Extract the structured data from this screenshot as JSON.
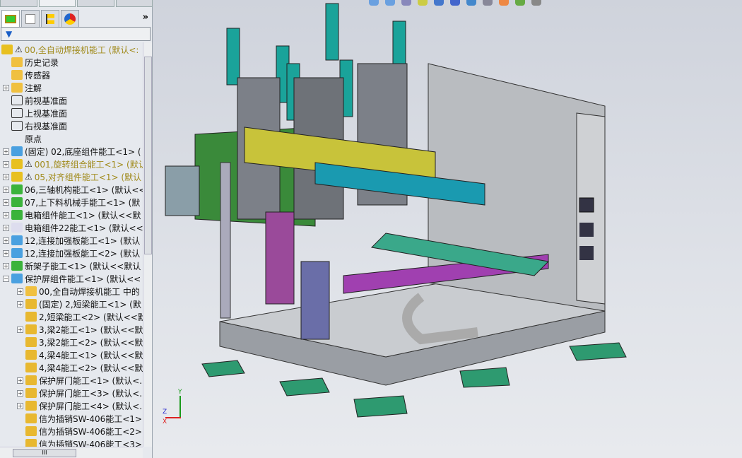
{
  "panel": {
    "filter_icon": "filter-icon",
    "more": "»",
    "tabs": [
      "feature-manager-icon",
      "property-manager-icon",
      "configuration-manager-icon",
      "display-manager-icon"
    ]
  },
  "tree": [
    {
      "label": "00,全自动焊接机能工 (默认<:",
      "icon": "assembly-warning",
      "level": 0,
      "warn": true
    },
    {
      "label": "历史记录",
      "icon": "history-icon",
      "level": 1
    },
    {
      "label": "传感器",
      "icon": "sensor-icon",
      "level": 1
    },
    {
      "label": "注解",
      "icon": "annotation-icon",
      "level": 1,
      "expand": "+"
    },
    {
      "label": "前视基准面",
      "icon": "plane-icon",
      "level": 1
    },
    {
      "label": "上视基准面",
      "icon": "plane-icon",
      "level": 1
    },
    {
      "label": "右视基准面",
      "icon": "plane-icon",
      "level": 1
    },
    {
      "label": "原点",
      "icon": "origin-icon",
      "level": 1
    },
    {
      "label": "(固定) 02,底座组件能工<1> (",
      "icon": "subassembly-icon",
      "level": 1,
      "expand": "+"
    },
    {
      "label": "001,旋转组合能工<1> (默认",
      "icon": "assembly-warning",
      "level": 1,
      "expand": "+",
      "warn": true
    },
    {
      "label": "05,对齐组件能工<1> (默认",
      "icon": "assembly-warning",
      "level": 1,
      "expand": "+",
      "warn": true
    },
    {
      "label": "06,三轴机构能工<1> (默认<<",
      "icon": "assembly-icon",
      "level": 1,
      "expand": "+"
    },
    {
      "label": "07,上下料机械手能工<1> (默",
      "icon": "assembly-icon",
      "level": 1,
      "expand": "+"
    },
    {
      "label": "电箱组件能工<1> (默认<<默",
      "icon": "assembly-icon",
      "level": 1,
      "expand": "+"
    },
    {
      "label": "电箱组件22能工<1> (默认<<",
      "icon": "assembly-hidden-icon",
      "level": 1,
      "expand": "+"
    },
    {
      "label": "12,连接加强板能工<1> (默认",
      "icon": "subassembly-icon",
      "level": 1,
      "expand": "+"
    },
    {
      "label": "12,连接加强板能工<2> (默认",
      "icon": "subassembly-icon",
      "level": 1,
      "expand": "+"
    },
    {
      "label": "新架子能工<1> (默认<<默认",
      "icon": "assembly-icon",
      "level": 1,
      "expand": "+"
    },
    {
      "label": "保护屏组件能工<1> (默认<<",
      "icon": "subassembly-icon",
      "level": 1,
      "expand": "−"
    },
    {
      "label": "00,全自动焊接机能工 中的",
      "icon": "folder-icon",
      "level": 2,
      "expand": "+"
    },
    {
      "label": "(固定) 2,短梁能工<1> (默",
      "icon": "part-icon",
      "level": 2,
      "expand": "+"
    },
    {
      "label": "2,短梁能工<2> (默认<<默",
      "icon": "part-icon",
      "level": 2
    },
    {
      "label": "3,梁2能工<1> (默认<<默",
      "icon": "part-icon",
      "level": 2,
      "expand": "+"
    },
    {
      "label": "3,梁2能工<2> (默认<<默",
      "icon": "part-icon",
      "level": 2
    },
    {
      "label": "4,梁4能工<1> (默认<<默",
      "icon": "part-icon",
      "level": 2
    },
    {
      "label": "4,梁4能工<2> (默认<<默",
      "icon": "part-icon",
      "level": 2
    },
    {
      "label": "保护屏门能工<1> (默认<.",
      "icon": "part-icon",
      "level": 2,
      "expand": "+"
    },
    {
      "label": "保护屏门能工<3> (默认<.",
      "icon": "part-icon",
      "level": 2,
      "expand": "+"
    },
    {
      "label": "保护屏门能工<4> (默认<.",
      "icon": "part-icon",
      "level": 2,
      "expand": "+"
    },
    {
      "label": "信为插销SW-406能工<1>",
      "icon": "part-icon",
      "level": 2
    },
    {
      "label": "信为插销SW-406能工<2>",
      "icon": "part-icon",
      "level": 2
    },
    {
      "label": "信为插销SW-406能工<3>",
      "icon": "part-icon",
      "level": 2
    }
  ],
  "toolbar": [
    "zoom-to-fit-icon",
    "zoom-area-icon",
    "previous-view-icon",
    "section-view-icon",
    "dynamic-annotation-icon",
    "view-orientation-icon",
    "display-style-icon",
    "hide-show-icon",
    "appearance-icon",
    "scene-icon",
    "view-settings-icon"
  ],
  "triad": {
    "y": "Y",
    "z": "Z",
    "x": "X"
  },
  "colors": {
    "warning": "#a08a1a",
    "viewport": "#d8dbe2"
  }
}
